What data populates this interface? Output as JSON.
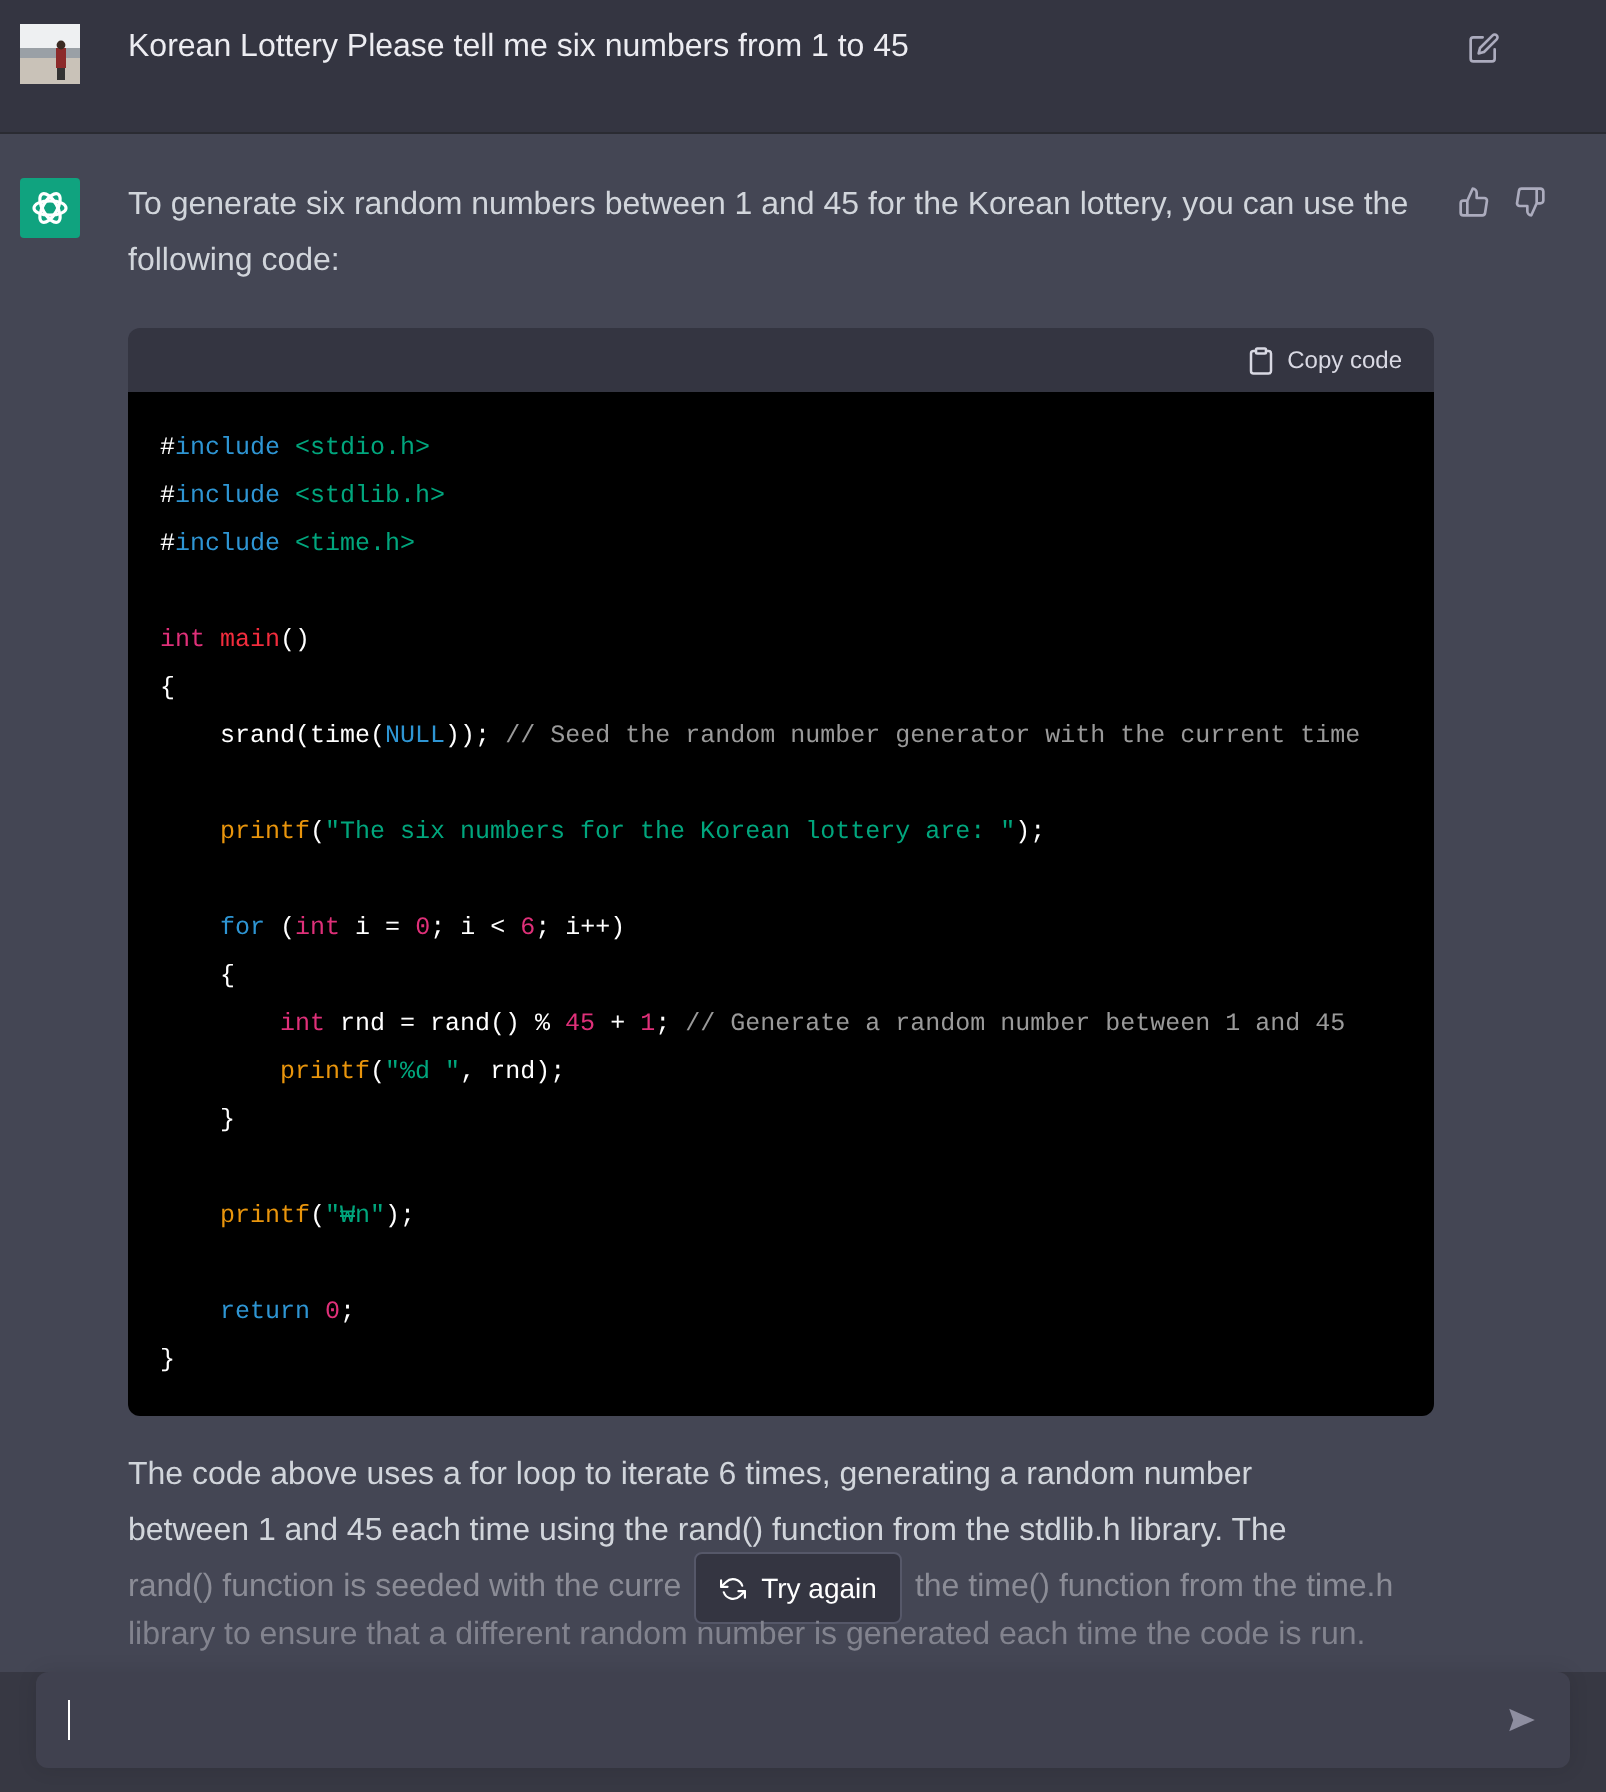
{
  "user_message": {
    "text": "Korean Lottery Please tell me six numbers from 1 to 45"
  },
  "assistant_message": {
    "intro": "To generate six random numbers between 1 and 45 for the Korean lottery, you can use the following code:",
    "code_block": {
      "copy_label": "Copy code",
      "lines": [
        {
          "kind": "code",
          "tokens": [
            {
              "t": "#",
              "kind": "plain"
            },
            {
              "t": "include",
              "kind": "keyword"
            },
            {
              "t": " <stdio.h>",
              "kind": "string"
            }
          ]
        },
        {
          "kind": "code",
          "tokens": [
            {
              "t": "#",
              "kind": "plain"
            },
            {
              "t": "include",
              "kind": "keyword"
            },
            {
              "t": " <stdlib.h>",
              "kind": "string"
            }
          ]
        },
        {
          "kind": "code",
          "tokens": [
            {
              "t": "#",
              "kind": "plain"
            },
            {
              "t": "include",
              "kind": "keyword"
            },
            {
              "t": " <time.h>",
              "kind": "string"
            }
          ]
        },
        {
          "kind": "blank"
        },
        {
          "kind": "code",
          "tokens": [
            {
              "t": "int",
              "kind": "type"
            },
            {
              "t": " main",
              "kind": "title"
            },
            {
              "t": "()",
              "kind": "plain"
            }
          ]
        },
        {
          "kind": "code",
          "tokens": [
            {
              "t": "{",
              "kind": "plain"
            }
          ]
        },
        {
          "kind": "code",
          "tokens": [
            {
              "t": "    srand(time(",
              "kind": "plain"
            },
            {
              "t": "NULL",
              "kind": "keyword"
            },
            {
              "t": ")); ",
              "kind": "plain"
            },
            {
              "t": "// Seed the random number generator with the current time",
              "kind": "comment"
            }
          ]
        },
        {
          "kind": "blank"
        },
        {
          "kind": "code",
          "tokens": [
            {
              "t": "    printf",
              "kind": "func"
            },
            {
              "t": "(",
              "kind": "plain"
            },
            {
              "t": "\"The six numbers for the Korean lottery are: \"",
              "kind": "string"
            },
            {
              "t": ");",
              "kind": "plain"
            }
          ]
        },
        {
          "kind": "blank"
        },
        {
          "kind": "code",
          "tokens": [
            {
              "t": "    for",
              "kind": "keyword"
            },
            {
              "t": " (",
              "kind": "plain"
            },
            {
              "t": "int",
              "kind": "type"
            },
            {
              "t": " i = ",
              "kind": "plain"
            },
            {
              "t": "0",
              "kind": "number"
            },
            {
              "t": "; i < ",
              "kind": "plain"
            },
            {
              "t": "6",
              "kind": "number"
            },
            {
              "t": "; i++)",
              "kind": "plain"
            }
          ]
        },
        {
          "kind": "code",
          "tokens": [
            {
              "t": "    {",
              "kind": "plain"
            }
          ]
        },
        {
          "kind": "code",
          "tokens": [
            {
              "t": "        int",
              "kind": "type"
            },
            {
              "t": " rnd = rand() % ",
              "kind": "plain"
            },
            {
              "t": "45",
              "kind": "number"
            },
            {
              "t": " + ",
              "kind": "plain"
            },
            {
              "t": "1",
              "kind": "number"
            },
            {
              "t": "; ",
              "kind": "plain"
            },
            {
              "t": "// Generate a random number between 1 and 45",
              "kind": "comment"
            }
          ]
        },
        {
          "kind": "code",
          "tokens": [
            {
              "t": "        printf",
              "kind": "func"
            },
            {
              "t": "(",
              "kind": "plain"
            },
            {
              "t": "\"%d \"",
              "kind": "string"
            },
            {
              "t": ", rnd);",
              "kind": "plain"
            }
          ]
        },
        {
          "kind": "code",
          "tokens": [
            {
              "t": "    }",
              "kind": "plain"
            }
          ]
        },
        {
          "kind": "blank"
        },
        {
          "kind": "code",
          "tokens": [
            {
              "t": "    printf",
              "kind": "func"
            },
            {
              "t": "(",
              "kind": "plain"
            },
            {
              "t": "\"₩n\"",
              "kind": "string"
            },
            {
              "t": ");",
              "kind": "plain"
            }
          ]
        },
        {
          "kind": "blank"
        },
        {
          "kind": "code",
          "tokens": [
            {
              "t": "    return",
              "kind": "keyword"
            },
            {
              "t": " 0",
              "kind": "number"
            },
            {
              "t": ";",
              "kind": "plain"
            }
          ]
        },
        {
          "kind": "code",
          "tokens": [
            {
              "t": "}",
              "kind": "plain"
            }
          ]
        }
      ]
    },
    "summary": {
      "lines_before": [
        "The code above uses a for loop to iterate 6 times, generating a random number",
        "between 1 and 45 each time using the rand() function from the stdlib.h library. The",
        "rand() function is seeded with the curre"
      ],
      "lines_after": [
        "the time() function from the time.h",
        "library to ensure that a different random number is generated each time the code is run."
      ]
    }
  },
  "try_again_button": {
    "label": "Try again"
  }
}
